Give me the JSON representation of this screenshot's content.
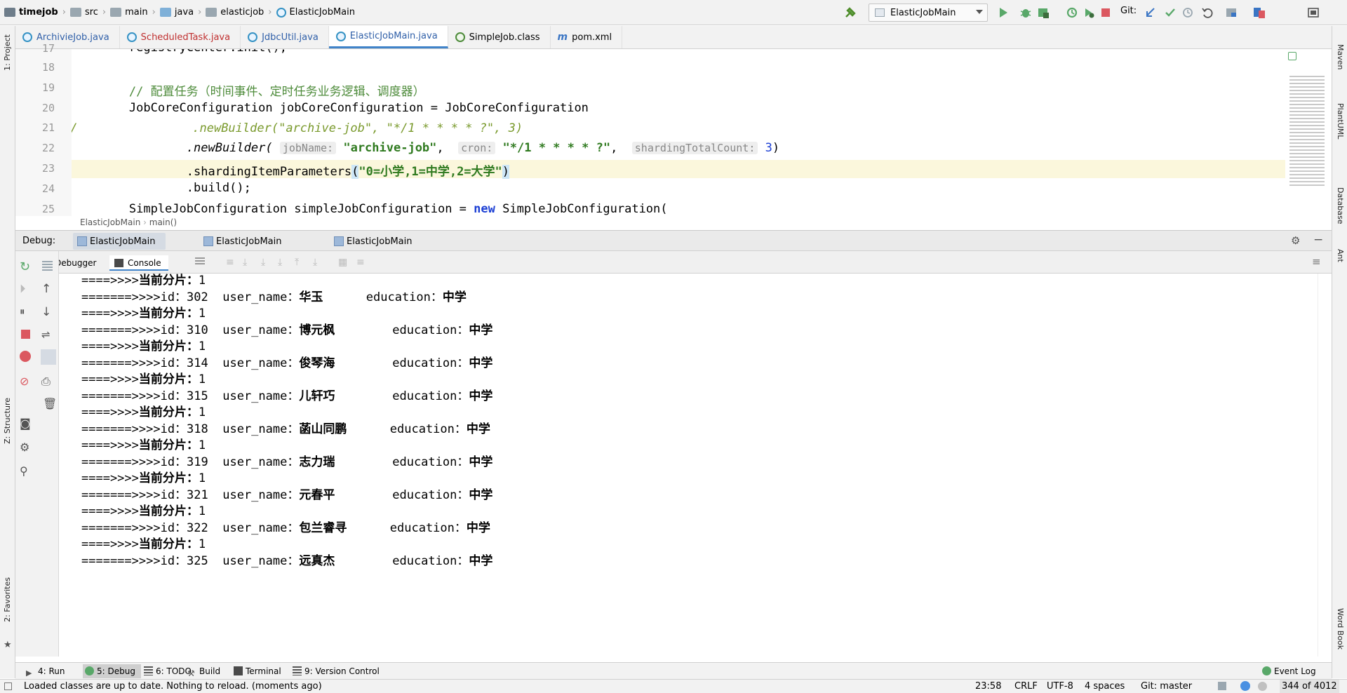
{
  "navbar": {
    "breadcrumbs": [
      "timejob",
      "src",
      "main",
      "java",
      "elasticjob",
      "ElasticJobMain"
    ],
    "run_config": "ElasticJobMain",
    "git_label": "Git:"
  },
  "tabs": [
    {
      "label": "ArchivieJob.java",
      "kind": "class"
    },
    {
      "label": "ScheduledTask.java",
      "kind": "class-error"
    },
    {
      "label": "JdbcUtil.java",
      "kind": "class"
    },
    {
      "label": "ElasticJobMain.java",
      "kind": "class-active"
    },
    {
      "label": "SimpleJob.class",
      "kind": "compiled"
    },
    {
      "label": "pom.xml",
      "kind": "maven"
    }
  ],
  "left_stripe": {
    "project": "1: Project",
    "structure": "Z: Structure",
    "favorites": "2: Favorites"
  },
  "right_stripe": {
    "maven": "Maven",
    "plantuml": "PlantUML",
    "database": "Database",
    "ant": "Ant",
    "wordbook": "Word Book"
  },
  "editor": {
    "lines": [
      {
        "n": "17",
        "text": "        registryCenter.init();"
      },
      {
        "n": "18",
        "text": ""
      },
      {
        "n": "19",
        "comment": "        // 配置任务（时间事件、定时任务业务逻辑、调度器）"
      },
      {
        "n": "20",
        "text": "        JobCoreConfiguration jobCoreConfiguration = JobCoreConfiguration"
      },
      {
        "n": "21",
        "prefix": "//",
        "pad": "                ",
        "method": ".newBuilder(",
        "args": "\"archive-job\", \"*/1 * * * * ?\", 3)"
      },
      {
        "n": "22",
        "pad": "                ",
        "call": ".newBuilder(",
        "hint1": "jobName:",
        "arg1": "\"archive-job\"",
        "hint2": "cron:",
        "arg2": "\"*/1 * * * * ?\"",
        "hint3": "shardingTotalCount:",
        "arg3": "3",
        "close": ")"
      },
      {
        "n": "23",
        "pad": "                ",
        "call": ".shardingItemParameters",
        "open": "(",
        "arg": "\"0=小学,1=中学,2=大学\"",
        "close": ")"
      },
      {
        "n": "24",
        "text": "                .build();"
      },
      {
        "n": "25",
        "text": "        SimpleJobConfiguration simpleJobConfiguration = ",
        "kw": "new",
        "rest": " SimpleJobConfiguration("
      }
    ],
    "crumbs": [
      "ElasticJobMain",
      "main()"
    ]
  },
  "debug": {
    "label": "Debug:",
    "sessions": [
      "ElasticJobMain",
      "ElasticJobMain",
      "ElasticJobMain"
    ],
    "subtabs": [
      "Debugger",
      "Console"
    ]
  },
  "console": {
    "shard_prefix": "====>>>>",
    "shard_label": "当前分片：",
    "shard_value": "1",
    "top_shard": "====>>>>当前分片：1",
    "rows": [
      {
        "id": "302",
        "name": "华玉",
        "edu": "中学"
      },
      {
        "id": "310",
        "name": "博元枫",
        "edu": "中学"
      },
      {
        "id": "314",
        "name": "俊琴海",
        "edu": "中学"
      },
      {
        "id": "315",
        "name": "儿轩巧",
        "edu": "中学"
      },
      {
        "id": "318",
        "name": "菡山同鹏",
        "edu": "中学"
      },
      {
        "id": "319",
        "name": "志力瑞",
        "edu": "中学"
      },
      {
        "id": "321",
        "name": "元春平",
        "edu": "中学"
      },
      {
        "id": "322",
        "name": "包兰睿寻",
        "edu": "中学"
      },
      {
        "id": "325",
        "name": "远真杰",
        "edu": "中学"
      }
    ],
    "row_prefix": "=======>>>>id：",
    "user_label": "user_name：",
    "edu_label": "education："
  },
  "bottom_tabs": [
    {
      "label": "4: Run"
    },
    {
      "label": "5: Debug"
    },
    {
      "label": "6: TODO"
    },
    {
      "label": "Build"
    },
    {
      "label": "Terminal"
    },
    {
      "label": "9: Version Control"
    }
  ],
  "event_log": "Event Log",
  "status": {
    "message": "Loaded classes are up to date. Nothing to reload. (moments ago)",
    "position": "23:58",
    "line_sep": "CRLF",
    "encoding": "UTF-8",
    "indent": "4 spaces",
    "branch": "Git: master",
    "memory": "344 of 4012"
  },
  "colors": {
    "accent": "#4083c9",
    "comment": "#4d8b3a",
    "string": "#2f7a1f",
    "number": "#1c3fd4"
  }
}
